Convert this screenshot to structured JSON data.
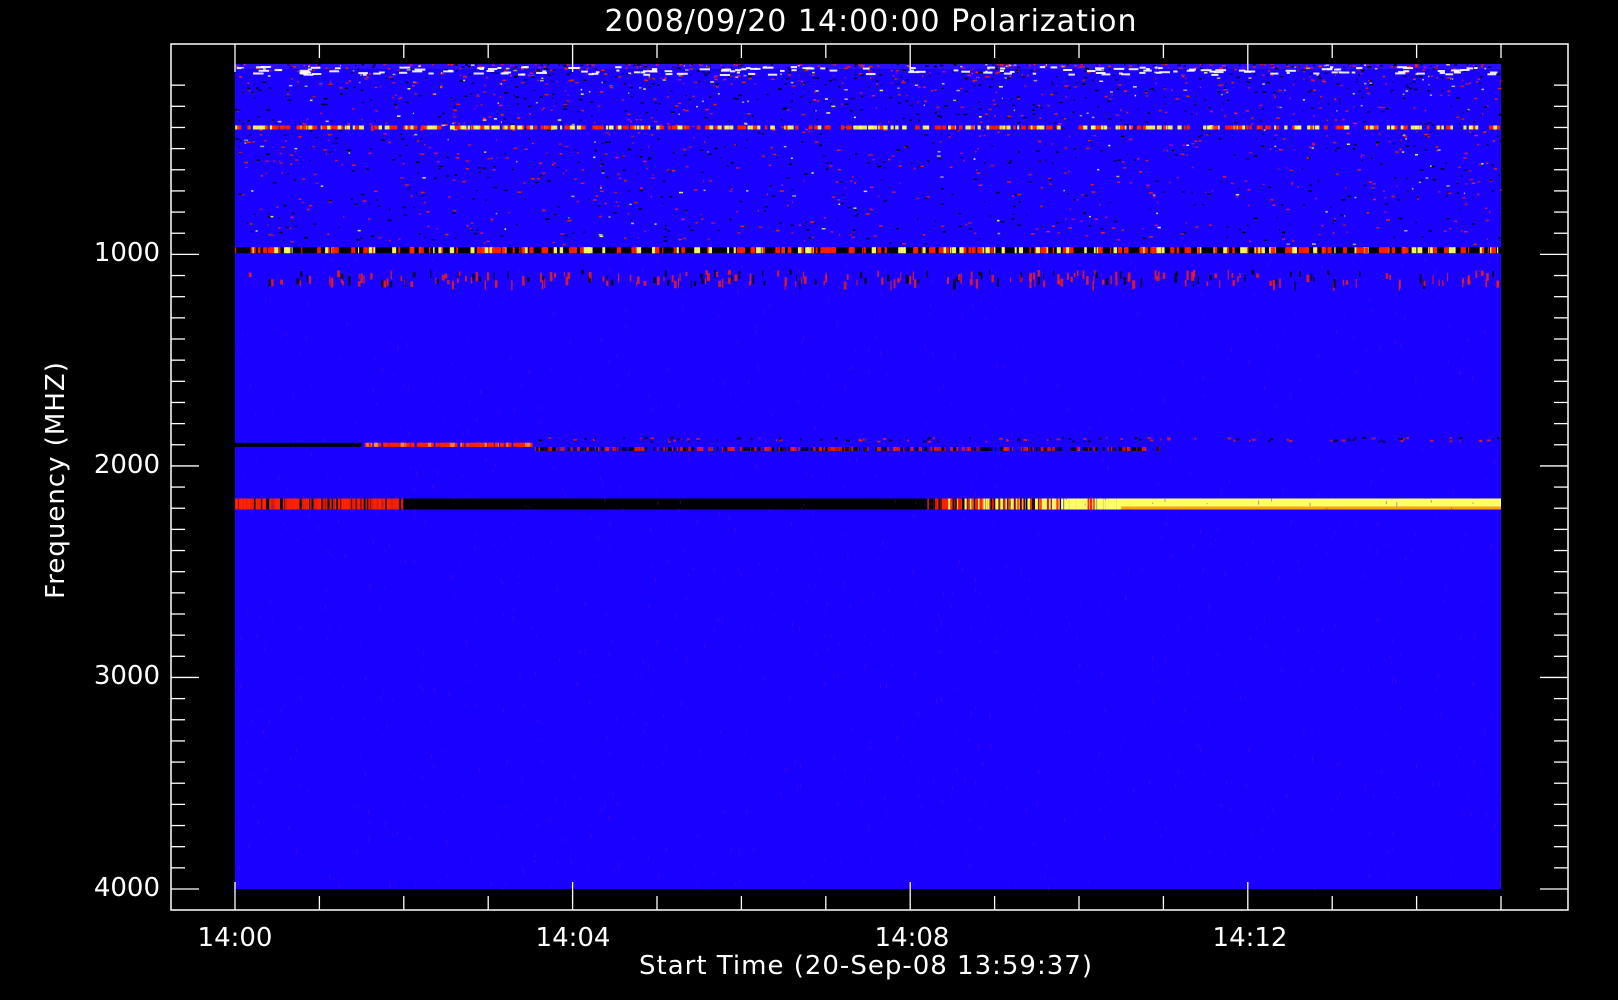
{
  "chart_data": {
    "type": "heatmap",
    "title": "2008/09/20 14:00:00 Polarization",
    "xlabel": "Start Time (20-Sep-08 13:59:37)",
    "ylabel": "Frequency (MHZ)",
    "x_ticks": [
      "14:00",
      "14:04",
      "14:08",
      "14:12"
    ],
    "y_ticks": [
      "1000",
      "2000",
      "3000",
      "4000"
    ],
    "x_range_minutes": [
      0,
      15
    ],
    "ylim": [
      4000,
      100
    ],
    "y_axis_inverted": true,
    "colormap": [
      "#000000",
      "#1a00ff",
      "#ff2200",
      "#ffff66"
    ],
    "background_color": "#1a00ff",
    "noisy_region_mhz": [
      100,
      950
    ],
    "bands": [
      {
        "freq_mhz": 980,
        "kind": "mixed",
        "intensity": 0.5
      },
      {
        "freq_mhz": 1100,
        "kind": "sparse",
        "intensity": 0.3
      },
      {
        "freq_mhz": 1900,
        "kind": "dark_then_red",
        "start_min": 0,
        "end_min": 3.5
      },
      {
        "freq_mhz": 1920,
        "kind": "mixed_faint",
        "start_min": 3.5,
        "end_min": 15
      },
      {
        "freq_mhz": 2180,
        "kind": "dark_to_bright",
        "dark_end_min": 8.2,
        "bright_start_min": 10.5
      }
    ]
  }
}
